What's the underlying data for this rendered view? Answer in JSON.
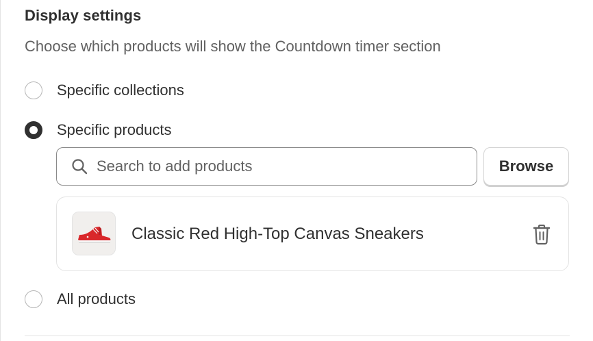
{
  "section": {
    "title": "Display settings",
    "description": "Choose which products will show the Countdown timer section"
  },
  "options": [
    {
      "label": "Specific collections",
      "checked": false
    },
    {
      "label": "Specific products",
      "checked": true
    },
    {
      "label": "All products",
      "checked": false
    }
  ],
  "search": {
    "placeholder": "Search to add products",
    "value": "",
    "icon": "search-icon"
  },
  "browse_button": {
    "label": "Browse"
  },
  "selected_products": [
    {
      "name": "Classic Red High-Top Canvas Sneakers",
      "thumbnail": "red-sneaker-image",
      "action_icon": "trash-icon"
    }
  ],
  "colors": {
    "text_primary": "#303030",
    "text_secondary": "#616161",
    "border": "#e3e3e3",
    "sneaker_red": "#d9272a"
  }
}
